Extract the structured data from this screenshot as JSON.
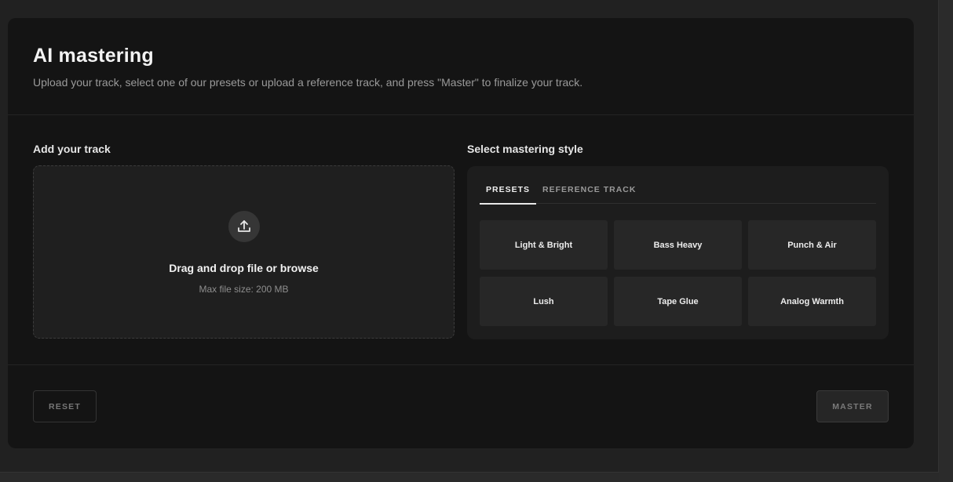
{
  "header": {
    "title": "AI mastering",
    "subtitle": "Upload your track, select one of our presets or upload a reference track, and press \"Master\" to finalize your track."
  },
  "upload": {
    "section_label": "Add your track",
    "icon": "upload-icon",
    "title": "Drag and drop file or browse",
    "subtitle": "Max file size: 200 MB"
  },
  "style": {
    "section_label": "Select mastering style",
    "tabs": [
      {
        "label": "PRESETS",
        "active": true
      },
      {
        "label": "REFERENCE TRACK",
        "active": false
      }
    ],
    "presets": [
      {
        "label": "Light & Bright"
      },
      {
        "label": "Bass Heavy"
      },
      {
        "label": "Punch & Air"
      },
      {
        "label": "Lush"
      },
      {
        "label": "Tape Glue"
      },
      {
        "label": "Analog Warmth"
      }
    ]
  },
  "footer": {
    "reset_label": "RESET",
    "master_label": "MASTER"
  },
  "colors": {
    "background": "#141414",
    "panel": "#1d1d1d",
    "preset_tile": "#272727",
    "text_primary": "#ececec",
    "text_muted": "#9a9a9a"
  }
}
